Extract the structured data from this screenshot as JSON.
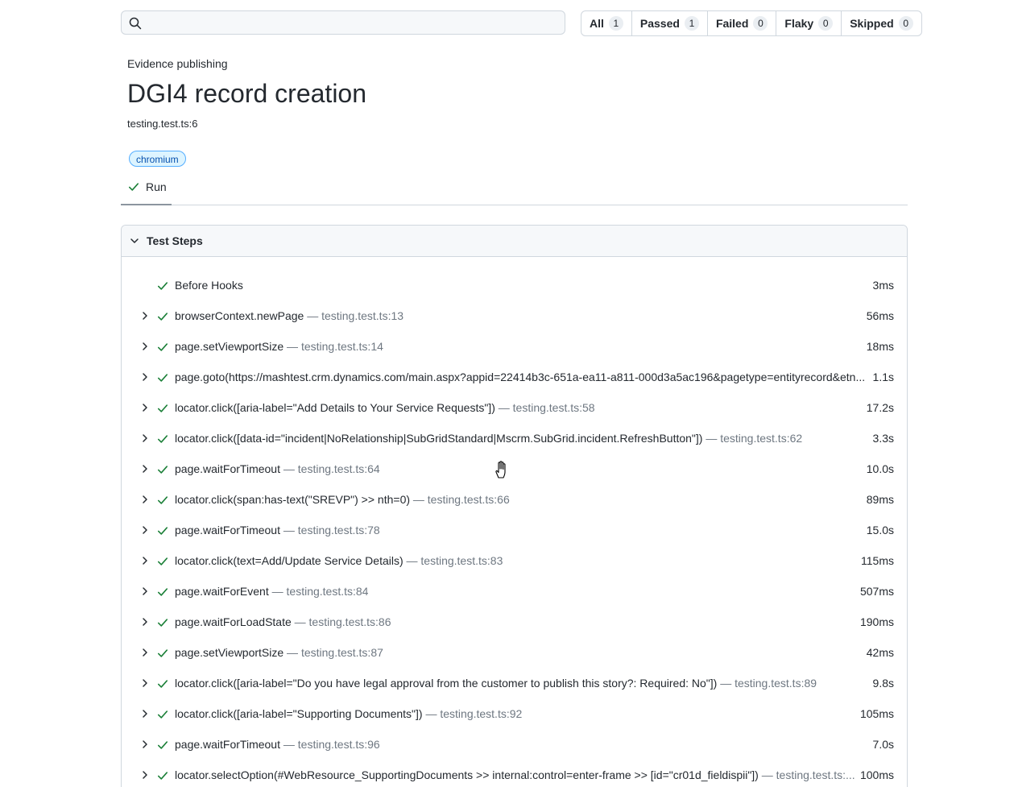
{
  "search": {
    "placeholder": "",
    "value": ""
  },
  "filters": [
    {
      "label": "All",
      "count": "1"
    },
    {
      "label": "Passed",
      "count": "1"
    },
    {
      "label": "Flaky",
      "count": "0"
    },
    {
      "label": "Failed",
      "count": "0"
    },
    {
      "label": "Skipped",
      "count": "0"
    }
  ],
  "header": {
    "project": "Evidence publishing",
    "title": "DGI4 record creation",
    "location": "testing.test.ts:6",
    "tag": "chromium"
  },
  "tabs": {
    "run_label": "Run"
  },
  "steps_panel": {
    "header_label": "Test Steps",
    "steps": [
      {
        "title": "Before Hooks",
        "location": "",
        "duration": "3ms",
        "expandable": false
      },
      {
        "title": "browserContext.newPage",
        "location": " — testing.test.ts:13",
        "duration": "56ms",
        "expandable": true
      },
      {
        "title": "page.setViewportSize",
        "location": " — testing.test.ts:14",
        "duration": "18ms",
        "expandable": true
      },
      {
        "title": "page.goto(https://mashtest.crm.dynamics.com/main.aspx?appid=22414b3c-651a-ea11-a811-000d3a5ac196&pagetype=entityrecord&etn...",
        "location": "",
        "duration": "1.1s",
        "expandable": true
      },
      {
        "title": "locator.click([aria-label=\"Add Details to Your Service Requests\"])",
        "location": " — testing.test.ts:58",
        "duration": "17.2s",
        "expandable": true
      },
      {
        "title": "locator.click([data-id=\"incident|NoRelationship|SubGridStandard|Mscrm.SubGrid.incident.RefreshButton\"])",
        "location": " — testing.test.ts:62",
        "duration": "3.3s",
        "expandable": true
      },
      {
        "title": "page.waitForTimeout",
        "location": " — testing.test.ts:64",
        "duration": "10.0s",
        "expandable": true
      },
      {
        "title": "locator.click(span:has-text(\"SREVP\") >> nth=0)",
        "location": " — testing.test.ts:66",
        "duration": "89ms",
        "expandable": true
      },
      {
        "title": "page.waitForTimeout",
        "location": " — testing.test.ts:78",
        "duration": "15.0s",
        "expandable": true
      },
      {
        "title": "locator.click(text=Add/Update Service Details)",
        "location": " — testing.test.ts:83",
        "duration": "115ms",
        "expandable": true
      },
      {
        "title": "page.waitForEvent",
        "location": " — testing.test.ts:84",
        "duration": "507ms",
        "expandable": true
      },
      {
        "title": "page.waitForLoadState",
        "location": " — testing.test.ts:86",
        "duration": "190ms",
        "expandable": true
      },
      {
        "title": "page.setViewportSize",
        "location": " — testing.test.ts:87",
        "duration": "42ms",
        "expandable": true
      },
      {
        "title": "locator.click([aria-label=\"Do you have legal approval from the customer to publish this story?: Required: No\"])",
        "location": " — testing.test.ts:89",
        "duration": "9.8s",
        "expandable": true
      },
      {
        "title": "locator.click([aria-label=\"Supporting Documents\"])",
        "location": " — testing.test.ts:92",
        "duration": "105ms",
        "expandable": true
      },
      {
        "title": "page.waitForTimeout",
        "location": " — testing.test.ts:96",
        "duration": "7.0s",
        "expandable": true
      },
      {
        "title": "locator.selectOption(#WebResource_SupportingDocuments >> internal:control=enter-frame >> [id=\"cr01d_fieldispii\"])",
        "location": " — testing.test.ts:...",
        "duration": "100ms",
        "expandable": true
      }
    ]
  },
  "colors": {
    "success": "#1a7f37",
    "border": "#d0d7de",
    "muted": "#6e7781",
    "tag_bg": "#ddf4ff",
    "tag_fg": "#0550ae"
  }
}
